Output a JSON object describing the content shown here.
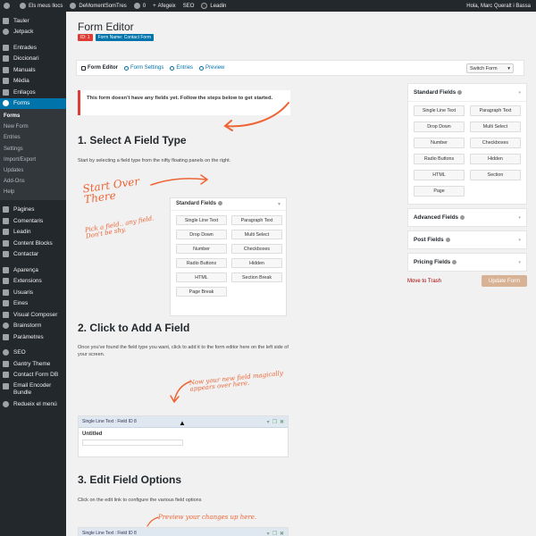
{
  "adminbar": {
    "site_name": "Els meus llocs",
    "site_title": "DeMomentSomTres",
    "comments_count": "0",
    "items": [
      "Afegeix",
      "SEO"
    ],
    "leadin": "Leadin",
    "greeting": "Hola, Marc Queralt i Bassa"
  },
  "sidemenu": {
    "top": [
      {
        "label": "Tauler",
        "icon": "dashboard-icon"
      },
      {
        "label": "Jetpack",
        "icon": "jetpack-icon"
      }
    ],
    "group2": [
      {
        "label": "Entrades",
        "icon": "pin-icon"
      },
      {
        "label": "Diccionari",
        "icon": "book-icon"
      },
      {
        "label": "Manuals",
        "icon": "pin-icon"
      },
      {
        "label": "Mèdia",
        "icon": "media-icon"
      },
      {
        "label": "Enllaços",
        "icon": "link-icon"
      }
    ],
    "current": {
      "label": "Forms",
      "icon": "forms-icon"
    },
    "submenu": [
      "Forms",
      "New Form",
      "Entries",
      "Settings",
      "Import/Export",
      "Updates",
      "Add-Ons",
      "Help"
    ],
    "group3": [
      {
        "label": "Pàgines",
        "icon": "page-icon"
      },
      {
        "label": "Comentaris",
        "icon": "comment-icon"
      },
      {
        "label": "Leadin",
        "icon": "leadin-icon"
      },
      {
        "label": "Content Blocks",
        "icon": "blocks-icon"
      },
      {
        "label": "Contactar",
        "icon": "mail-icon"
      }
    ],
    "group4": [
      {
        "label": "Aparença",
        "icon": "brush-icon"
      },
      {
        "label": "Extensions",
        "icon": "plugin-icon"
      },
      {
        "label": "Usuaris",
        "icon": "users-icon"
      },
      {
        "label": "Eines",
        "icon": "tools-icon"
      },
      {
        "label": "Visual Composer",
        "icon": "composer-icon"
      },
      {
        "label": "Brainstorm",
        "icon": "brainstorm-icon"
      },
      {
        "label": "Paràmetres",
        "icon": "settings-icon"
      }
    ],
    "group5": [
      {
        "label": "SEO",
        "icon": "seo-icon"
      },
      {
        "label": "Gantry Theme",
        "icon": "gantry-icon"
      },
      {
        "label": "Contact Form DB",
        "icon": "database-icon"
      }
    ],
    "email_encoder": "Email Encoder Bundle",
    "collapse": "Redueix el menú"
  },
  "header": {
    "title": "Form Editor",
    "id_badge": "ID: 1",
    "form_name_badge": "Form Name: Contact Form"
  },
  "toolbar": {
    "links": [
      {
        "label": "Form Editor",
        "active": true
      },
      {
        "label": "Form Settings",
        "active": false
      },
      {
        "label": "Entries",
        "active": false
      },
      {
        "label": "Preview",
        "active": false
      }
    ],
    "switch_form": "Switch Form"
  },
  "content": {
    "notice": "This form doesn't have any fields yet. Follow the steps below to get started.",
    "step1_title": "1. Select A Field Type",
    "step1_text": "Start by selecting a field type from the nifty floating panels on the right.",
    "hand_start": "Start Over There",
    "hand_pick": "Pick a field.. any field. Don't be shy.",
    "demo_panel_title": "Standard Fields",
    "demo_fields": [
      "Single Line Text",
      "Paragraph Text",
      "Drop Down",
      "Multi Select",
      "Number",
      "Checkboxes",
      "Radio Buttons",
      "Hidden",
      "HTML",
      "Section Break",
      "Page Break"
    ],
    "step2_title": "2. Click to Add A Field",
    "step2_text": "Once you've found the field type you want, click to add it to the form editor here on the left side of your screen.",
    "hand_new_field": "Now your new field magically appears over here.",
    "field_preview_head": "Single Line Text : Field ID 8",
    "field_preview_label": "Untitled",
    "step3_title": "3. Edit Field Options",
    "step3_text": "Click on the edit link to configure the various field options",
    "hand_preview": "Preview your changes up here.",
    "field_preview_head2": "Single Line Text : Field ID 8"
  },
  "sidebar": {
    "standard_title": "Standard Fields",
    "standard_fields": [
      "Single Line Text",
      "Paragraph Text",
      "Drop Down",
      "Multi Select",
      "Number",
      "Checkboxes",
      "Radio Buttons",
      "Hidden",
      "HTML",
      "Section",
      "Page"
    ],
    "advanced_title": "Advanced Fields",
    "post_title": "Post Fields",
    "pricing_title": "Pricing Fields",
    "trash": "Move to Trash",
    "update": "Update Form"
  },
  "colors": {
    "accent": "#0073aa",
    "menu_bg": "#23282d",
    "handwriting": "#ee6433",
    "notice_border": "#dd3d36",
    "update_button": "#d8b294"
  }
}
